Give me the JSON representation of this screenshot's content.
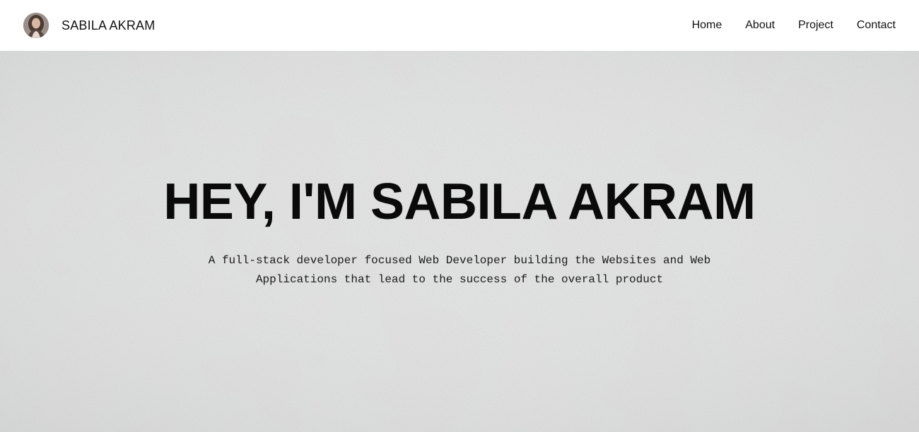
{
  "header": {
    "brand_name": "SABILA AKRAM",
    "avatar_icon": "profile-photo-avatar"
  },
  "nav": {
    "items": [
      {
        "label": "Home"
      },
      {
        "label": "About"
      },
      {
        "label": "Project"
      },
      {
        "label": "Contact"
      }
    ]
  },
  "hero": {
    "title": "HEY, I'M SABILA AKRAM",
    "subtitle": "A full-stack developer focused Web Developer building the Websites and Web Applications that lead to the success of the overall product",
    "background": "white-textured-wall"
  },
  "colors": {
    "header_bg": "#ffffff",
    "text": "#111111",
    "hero_bg": "#e4e4e4"
  }
}
